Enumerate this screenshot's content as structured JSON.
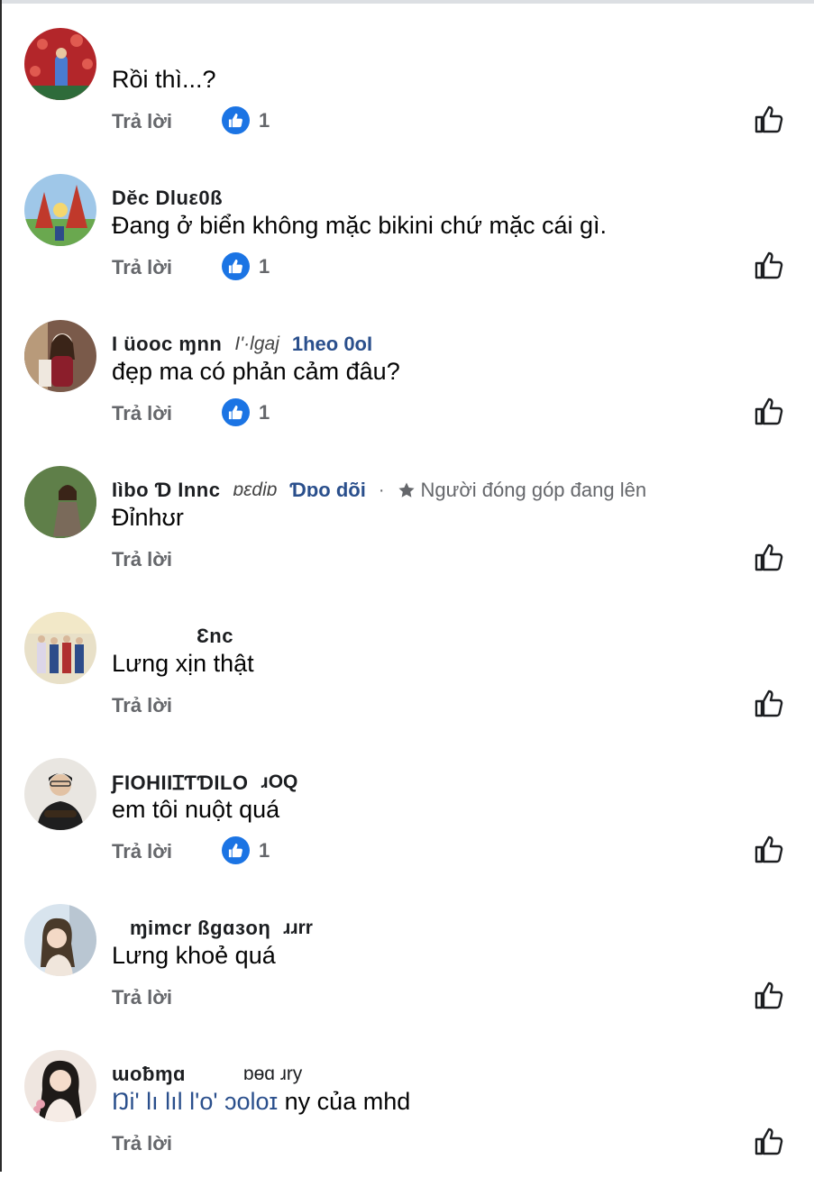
{
  "comments": [
    {
      "name": "",
      "badge": "",
      "follow": "",
      "contributor": "",
      "text": "Rồi thì...?",
      "mention": "",
      "reply": "Trả lời",
      "likes": "1",
      "avatar": {
        "bg": "#b3262a",
        "fg": "#e8c6a0",
        "accent": "#4a7bd0"
      }
    },
    {
      "name": "Dĕc Dluε0ß",
      "badge": "",
      "follow": "",
      "contributor": "",
      "text": "Đang ở biển không mặc bikini chứ mặc cái gì.",
      "mention": "",
      "reply": "Trả lời",
      "likes": "1",
      "avatar": {
        "bg": "#9fc7e8",
        "fg": "#c0392b",
        "accent": "#6aa84f"
      }
    },
    {
      "name": "I üooc ɱnn",
      "badge": "I'·lgaj",
      "follow": "1heo 0oI",
      "contributor": "",
      "text": "đẹp ma có phản cảm đâu?",
      "mention": "",
      "reply": "Trả lời",
      "likes": "1",
      "avatar": {
        "bg": "#7a5a4a",
        "fg": "#f2e6da",
        "accent": "#8b1e2b"
      }
    },
    {
      "name": "Iìbo Ɗ Innc",
      "badge": "ɒɛdiɒ",
      "follow": "Ɗɒo dõi",
      "contributor": "Người đóng góp đang lên",
      "text": "Đỉnhʊr",
      "mention": "",
      "reply": "Trả lời",
      "likes": "",
      "avatar": {
        "bg": "#5f7f49",
        "fg": "#e8d8c8",
        "accent": "#3f5f8f"
      }
    },
    {
      "name": "Ɛnc",
      "badge": "",
      "follow": "",
      "contributor": "",
      "text": "Lưng xịn thật",
      "mention": "",
      "reply": "Trả lời",
      "likes": "",
      "avatar": {
        "bg": "#e8e0c8",
        "fg": "#2d4c8a",
        "accent": "#b03030"
      }
    },
    {
      "name": "ƑIOHIIꞮƬƊILO",
      "badge": "ɹOQ",
      "follow": "",
      "contributor": "",
      "text": "em tôi nuột quá",
      "mention": "",
      "reply": "Trả lời",
      "likes": "1",
      "avatar": {
        "bg": "#e9e6e1",
        "fg": "#1f1f1f",
        "accent": "#3a2a1a"
      }
    },
    {
      "name": "ɱimcr ßgɑɜoη",
      "badge": "ɹɹrr",
      "follow": "",
      "contributor": "",
      "text": "Lưng khoẻ quá",
      "mention": "",
      "reply": "Trả lời",
      "likes": "",
      "avatar": {
        "bg": "#d8e4ee",
        "fg": "#f3d9c6",
        "accent": "#4a3a2a"
      }
    },
    {
      "name": "ɯoƀɱɑ",
      "badge": "ɒɵɑ  ɹry",
      "follow": "",
      "contributor": "",
      "text": " ny của mhd",
      "mention": "Ŋi' lı lıl l'o' ɔoloɪ",
      "reply": "Trả lời",
      "likes": "",
      "avatar": {
        "bg": "#efe6e0",
        "fg": "#f5dccb",
        "accent": "#1e1a18"
      }
    }
  ]
}
